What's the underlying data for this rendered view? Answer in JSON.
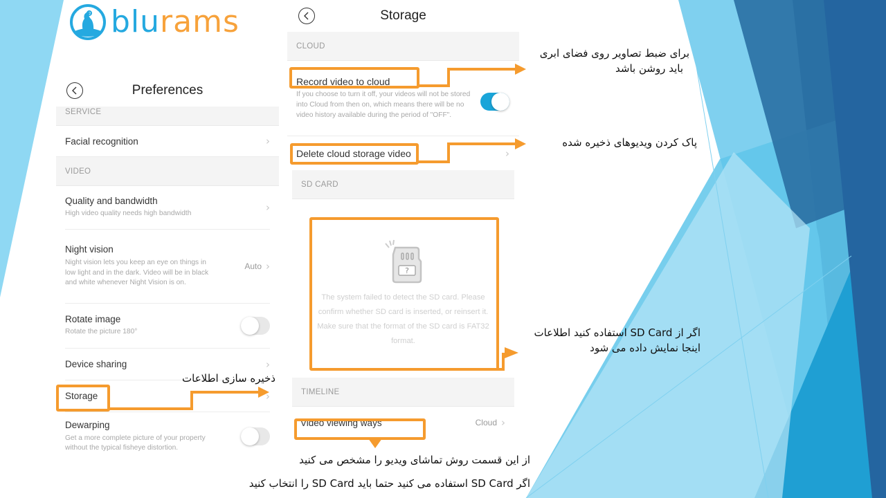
{
  "brand": {
    "logo_part1": "blu",
    "logo_part2": "rams",
    "colors": {
      "blue": "#25a9e0",
      "orange": "#f7a23b",
      "annotation": "#f59b2e",
      "toggle_on": "#1aa5d9"
    }
  },
  "preferences": {
    "title": "Preferences",
    "back_icon": "back-circle-icon",
    "sections": [
      {
        "header": "SERVICE"
      },
      {
        "header": "VIDEO"
      }
    ],
    "items": [
      {
        "title": "Facial recognition",
        "subtitle": "",
        "control": "chevron"
      },
      {
        "title": "Quality and bandwidth",
        "subtitle": "High video quality needs high bandwidth",
        "control": "chevron"
      },
      {
        "title": "Night vision",
        "subtitle": "Night vision lets you keep an eye on things in low light and in the dark. Video will be in black and white whenever Night Vision is on.",
        "value": "Auto",
        "control": "chevron"
      },
      {
        "title": "Rotate image",
        "subtitle": "Rotate the picture 180°",
        "control": "toggle",
        "on": false
      },
      {
        "title": "Device sharing",
        "subtitle": "",
        "control": "chevron"
      },
      {
        "title": "Storage",
        "subtitle": "",
        "control": "chevron"
      },
      {
        "title": "Dewarping",
        "subtitle": "Get a more complete picture of your property without the typical fisheye distortion.",
        "control": "toggle",
        "on": false
      }
    ]
  },
  "storage": {
    "title": "Storage",
    "sections": {
      "cloud": "CLOUD",
      "sd_card": "SD CARD",
      "timeline": "TIMELINE"
    },
    "record_to_cloud": {
      "title": "Record video to cloud",
      "subtitle": "If you choose to turn it off, your videos will not be stored into Cloud from then on, which means there will be no video history available during the period of \"OFF\".",
      "on": true
    },
    "delete_cloud": {
      "title": "Delete cloud storage video"
    },
    "sd_message": "The system failed to detect the SD card. Please confirm whether SD card is inserted, or reinsert it. Make sure that the format of the SD card is FAT32 format.",
    "video_viewing": {
      "title": "Video viewing ways",
      "value": "Cloud"
    }
  },
  "annotations": {
    "storage_note": "ذخیره سازی اطلاعات",
    "cloud_note_line1": "برای ضبط تصاویر روی فضای ابری",
    "cloud_note_line2": "باید روشن باشد",
    "delete_note": "پاک کردن ویدیوهای ذخیره شده",
    "sd_note_line1": "اگر از SD Card استفاده کنید اطلاعات",
    "sd_note_line2": "اینجا نمایش داده می شود",
    "viewing_note_line1": "از این قسمت روش تماشای ویدیو را مشخص می کنید",
    "viewing_note_line2": "اگر  SD Card استفاده می کنید حتما باید SD Card را انتخاب کنید"
  }
}
